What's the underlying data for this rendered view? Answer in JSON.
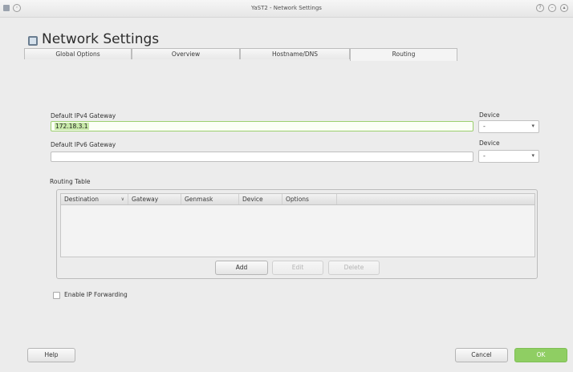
{
  "window": {
    "title": "YaST2 - Network Settings",
    "app_icon": "window-menu-icon",
    "left_button": "pin-icon",
    "controls": [
      "help-icon",
      "minimize-icon",
      "maximize-icon"
    ]
  },
  "header": {
    "icon": "network-icon",
    "title": "Network Settings"
  },
  "tabs": [
    {
      "label": "Global Options"
    },
    {
      "label": "Overview"
    },
    {
      "label": "Hostname/DNS"
    },
    {
      "label": "Routing",
      "active": true
    }
  ],
  "ipv4": {
    "label": "Default IPv4 Gateway",
    "value": "172.18.3.1",
    "device_label": "Device",
    "device_value": "-"
  },
  "ipv6": {
    "label": "Default IPv6 Gateway",
    "value": "",
    "device_label": "Device",
    "device_value": "-"
  },
  "routing_table": {
    "label": "Routing Table",
    "columns": [
      "Destination",
      "Gateway",
      "Genmask",
      "Device",
      "Options"
    ],
    "rows": []
  },
  "table_buttons": {
    "add": "Add",
    "edit": "Edit",
    "delete": "Delete"
  },
  "ip_forwarding": {
    "label": "Enable IP Forwarding",
    "checked": false
  },
  "footer": {
    "help": "Help",
    "cancel": "Cancel",
    "ok": "OK"
  },
  "colors": {
    "ok_button": "#8fce63",
    "focus_border": "#9ccf6f"
  }
}
